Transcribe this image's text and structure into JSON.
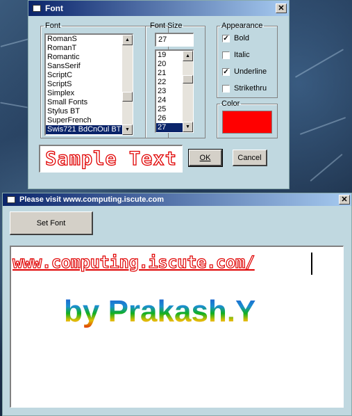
{
  "font_dialog": {
    "title": "Font",
    "font_group_label": "Font",
    "font_list": [
      "RomanS",
      "RomanT",
      "Romantic",
      "SansSerif",
      "ScriptC",
      "ScriptS",
      "Simplex",
      "Small Fonts",
      "Stylus BT",
      "SuperFrench",
      "Swis721 BdCnOul BT"
    ],
    "selected_font": "Swis721 BdCnOul BT",
    "size_group_label": "Font Size",
    "size_value": "27",
    "size_list": [
      "19",
      "20",
      "21",
      "22",
      "23",
      "24",
      "25",
      "26",
      "27"
    ],
    "selected_size": "27",
    "appearance_label": "Appearance",
    "appearance": [
      {
        "label": "Bold",
        "checked": true
      },
      {
        "label": "Italic",
        "checked": false
      },
      {
        "label": "Underline",
        "checked": true
      },
      {
        "label": "Strikethru",
        "checked": false
      }
    ],
    "color_label": "Color",
    "color_value": "#ff0000",
    "sample_text": "Sample Text",
    "ok_label": "OK",
    "cancel_label": "Cancel"
  },
  "main_window": {
    "title": "Please visit www.computing.iscute.com",
    "set_font_label": "Set Font",
    "url_text": "www.computing.iscute.com/",
    "byline_text": "by Prakash.Y"
  },
  "colors": {
    "titlebar_start": "#0a246a",
    "titlebar_end": "#a6caf0",
    "dialog_bg": "#c0d8e0",
    "accent_red": "#e00000"
  }
}
